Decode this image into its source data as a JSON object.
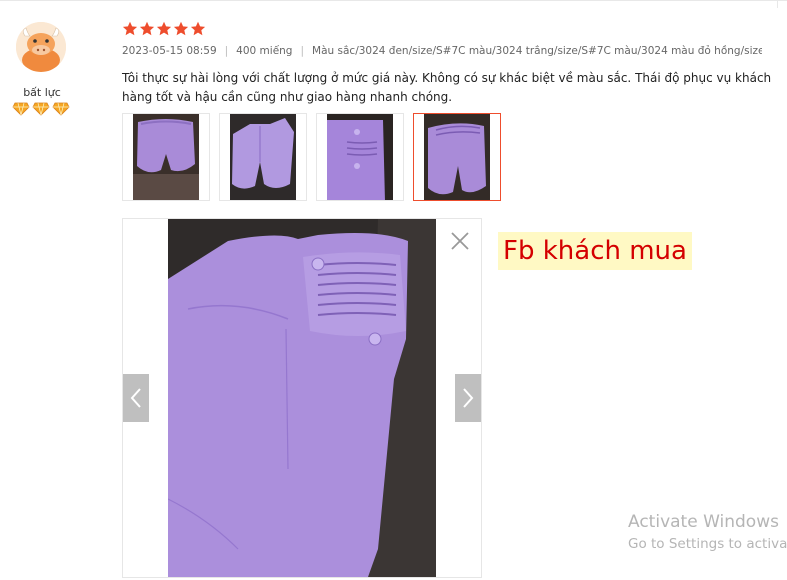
{
  "user": {
    "name": "bất lực",
    "avatar_icon": "cow-avatar-icon",
    "badge_icon": "diamond-badge-icon",
    "badge_count": 3
  },
  "review": {
    "rating": 5,
    "star_color": "#ee4d2d",
    "date": "2023-05-15 08:59",
    "quantity": "400 miếng",
    "variation": "Màu sắc/3024 đen/size/S#7C màu/3024 trắng/size/S#7C màu/3024 màu đỏ hồng/size/...",
    "text": "Tôi thực sự hài lòng với chất lượng ở mức giá này. Không có sự khác biệt về màu sắc. Thái độ phục vụ khách hàng tốt và hậu cần cũng như giao hàng nhanh chóng.",
    "separator": "|"
  },
  "media": {
    "thumbnail_count": 4,
    "active_index": 3,
    "accent_color": "#ee4d2d"
  },
  "viewer": {
    "prev_label": "<",
    "next_label": ">"
  },
  "annotation": {
    "label": "Fb khách mua",
    "color": "#d40000"
  },
  "watermark": {
    "line1": "Activate Windows",
    "line2": "Go to Settings to activate Windows."
  }
}
